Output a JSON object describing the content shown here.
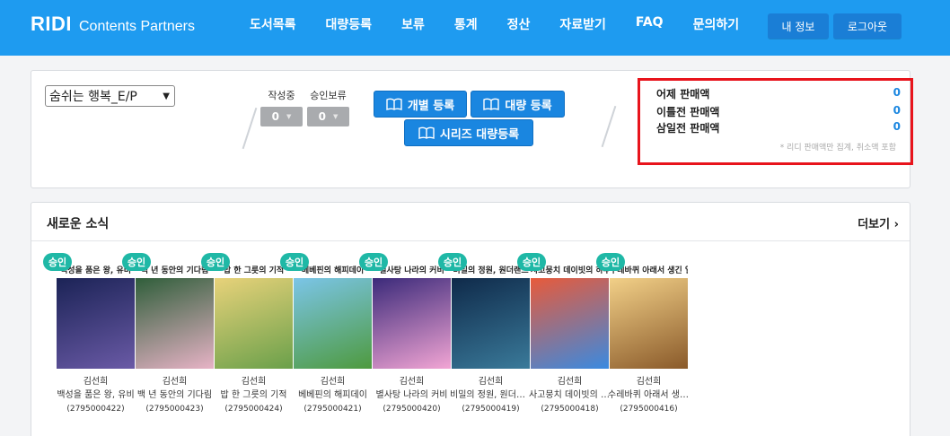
{
  "header": {
    "logo_mark": "RIDI",
    "logo_sub": "Contents Partners",
    "nav": [
      "도서목록",
      "대량등록",
      "보류",
      "통계",
      "정산",
      "자료받기",
      "FAQ",
      "문의하기"
    ],
    "my_info": "내 정보",
    "logout": "로그아웃"
  },
  "summary": {
    "book_select": "숨쉬는 행복_E/P",
    "writing_label": "작성중",
    "writing_value": "0",
    "pending_label": "승인보류",
    "pending_value": "0",
    "individual_register": "개별 등록",
    "bulk_register": "대량 등록",
    "series_bulk_register": "시리즈 대량등록",
    "sales": {
      "yesterday_label": "어제 판매액",
      "yesterday_value": "0",
      "two_days_label": "이틀전 판매액",
      "two_days_value": "0",
      "three_days_label": "삼일전 판매액",
      "three_days_value": "0",
      "note": "* 리디 판매액만 집계, 취소액 포함"
    }
  },
  "news": {
    "title": "새로운 소식",
    "more": "더보기",
    "books": [
      {
        "badge": "승인",
        "cover_title": "백성을 품은 왕, 유비",
        "author": "김선희",
        "title": "백성을 품은 왕, 유비",
        "code": "(2795000422)",
        "colors": [
          "#1b2356",
          "#6a5aa6"
        ]
      },
      {
        "badge": "승인",
        "cover_title": "백 년 동안의 기다림",
        "author": "김선희",
        "title": "백 년 동안의 기다림",
        "code": "(2795000423)",
        "colors": [
          "#2f5e3a",
          "#e7b3c6"
        ]
      },
      {
        "badge": "승인",
        "cover_title": "밥 한 그릇의 기적",
        "author": "김선희",
        "title": "밥 한 그릇의 기적",
        "code": "(2795000424)",
        "colors": [
          "#e8d27a",
          "#6aa04a"
        ]
      },
      {
        "badge": "승인",
        "cover_title": "베베핀의 해피데이",
        "author": "김선희",
        "title": "베베핀의 해피데이",
        "code": "(2795000421)",
        "colors": [
          "#7bc5e8",
          "#4e9a3e"
        ]
      },
      {
        "badge": "승인",
        "cover_title": "별사탕 나라의 커비",
        "author": "김선희",
        "title": "별사탕 나라의 커비",
        "code": "(2795000420)",
        "colors": [
          "#3b2a7a",
          "#f2a5d4"
        ]
      },
      {
        "badge": "승인",
        "cover_title": "비밀의 정원, 원더랜드",
        "author": "김선희",
        "title": "비밀의 정원, 원더랜드",
        "code": "(2795000419)",
        "colors": [
          "#0f2a4a",
          "#3a7a9a"
        ]
      },
      {
        "badge": "승인",
        "cover_title": "사고뭉치 데이빗의 하루",
        "author": "김선희",
        "title": "사고뭉치 데이빗의 하루",
        "code": "(2795000418)",
        "colors": [
          "#e85a3a",
          "#3a8ae0"
        ]
      },
      {
        "badge": "승인",
        "cover_title": "수레바퀴 아래서 생긴 일",
        "author": "김선희",
        "title": "수레바퀴 아래서 생긴 일",
        "code": "(2795000416)",
        "colors": [
          "#f2d088",
          "#8a5a2a"
        ]
      }
    ]
  }
}
